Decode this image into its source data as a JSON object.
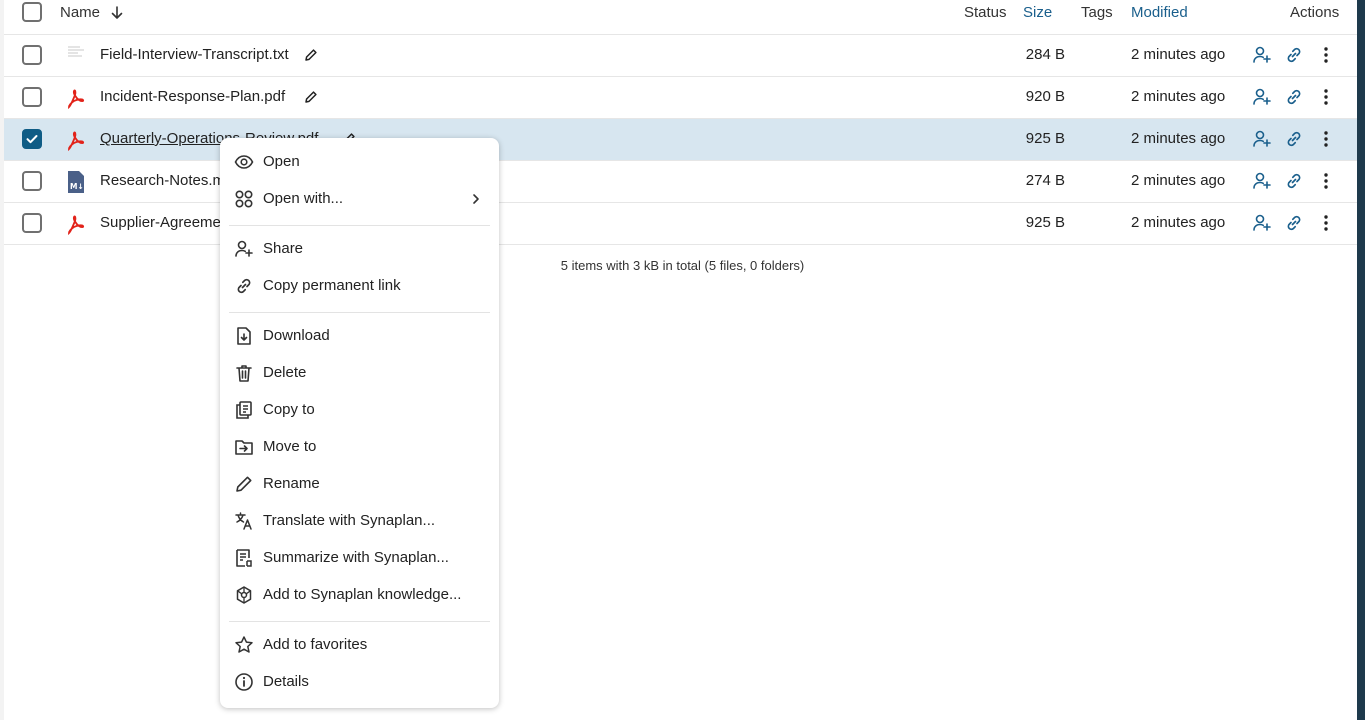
{
  "header": {
    "name_label": "Name",
    "status_label": "Status",
    "size_label": "Size",
    "tags_label": "Tags",
    "modified_label": "Modified",
    "actions_label": "Actions"
  },
  "files": [
    {
      "name": "Field-Interview-Transcript.txt",
      "type": "txt",
      "size": "284 B",
      "modified": "2 minutes ago",
      "selected": false
    },
    {
      "name": "Incident-Response-Plan.pdf",
      "type": "pdf",
      "size": "920 B",
      "modified": "2 minutes ago",
      "selected": false
    },
    {
      "name": "Quarterly-Operations-Review.pdf",
      "type": "pdf",
      "size": "925 B",
      "modified": "2 minutes ago",
      "selected": true
    },
    {
      "name": "Research-Notes.md",
      "type": "md",
      "size": "274 B",
      "modified": "2 minutes ago",
      "selected": false
    },
    {
      "name": "Supplier-Agreement.pdf",
      "type": "pdf",
      "size": "925 B",
      "modified": "2 minutes ago",
      "selected": false
    }
  ],
  "summary": "5 items with 3 kB in total (5 files, 0 folders)",
  "context_menu": {
    "items": [
      {
        "label": "Open",
        "icon": "eye-icon"
      },
      {
        "label": "Open with...",
        "icon": "apps-icon"
      },
      {
        "label": "Share",
        "icon": "share-user-icon"
      },
      {
        "label": "Copy permanent link",
        "icon": "link-icon"
      },
      {
        "label": "Download",
        "icon": "download-icon"
      },
      {
        "label": "Delete",
        "icon": "trash-icon"
      },
      {
        "label": "Copy to",
        "icon": "copy-icon"
      },
      {
        "label": "Move to",
        "icon": "move-icon"
      },
      {
        "label": "Rename",
        "icon": "pencil-icon"
      },
      {
        "label": "Translate with Synaplan...",
        "icon": "translate-icon"
      },
      {
        "label": "Summarize with Synaplan...",
        "icon": "summary-icon"
      },
      {
        "label": "Add to Synaplan knowledge...",
        "icon": "knowledge-icon"
      },
      {
        "label": "Add to favorites",
        "icon": "star-icon"
      },
      {
        "label": "Details",
        "icon": "info-icon"
      }
    ]
  },
  "colors": {
    "accent": "#0f5c85",
    "selected_row": "#d7e6f0",
    "pdf_red": "#e2231a",
    "header_blue": "#1a5f8c"
  }
}
